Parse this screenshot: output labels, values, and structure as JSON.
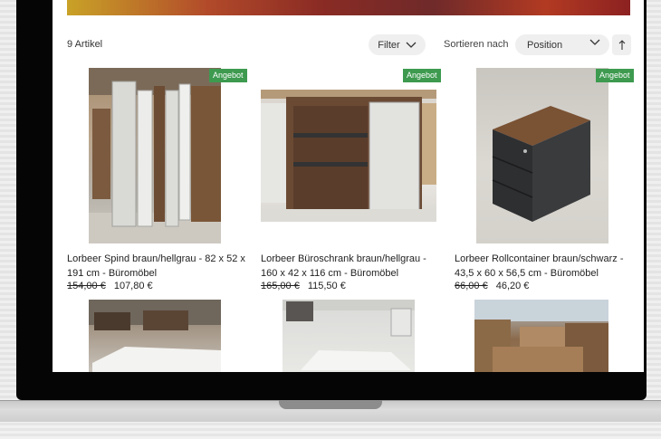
{
  "toolbar": {
    "count": "9 Artikel",
    "filter_label": "Filter",
    "sort_label": "Sortieren nach",
    "sort_value": "Position"
  },
  "products": [
    {
      "badge": "Angebot",
      "title": "Lorbeer Spind braun/hellgrau - 82 x 52 x 191 cm - Büromöbel",
      "old_price": "154,00 €",
      "price": "107,80 €"
    },
    {
      "badge": "Angebot",
      "title": "Lorbeer Büroschrank braun/hellgrau - 160 x 42 x 116 cm - Büromöbel",
      "old_price": "165,00 €",
      "price": "115,50 €"
    },
    {
      "badge": "Angebot",
      "title": "Lorbeer Rollcontainer braun/schwarz - 43,5 x 60 x 56,5 cm - Büromöbel",
      "old_price": "66,00 €",
      "price": "46,20 €"
    }
  ],
  "colors": {
    "badge": "#3d9a4f",
    "pill": "#efefef",
    "bezel": "#050505"
  },
  "icons": {
    "filter": "chevron-down-icon",
    "sort": "chevron-down-icon",
    "direction": "arrow-up-icon"
  }
}
